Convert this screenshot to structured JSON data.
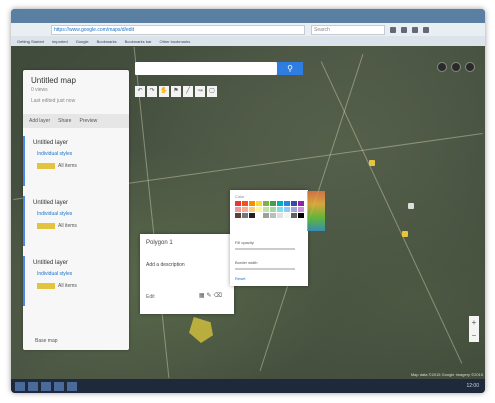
{
  "browser": {
    "url": "https://www.google.com/maps/d/edit",
    "search_placeholder": "Search",
    "bookmarks": [
      "Getting Started",
      "Imported",
      "Google",
      "Bookmarks",
      "Bookmarks bar",
      "Other bookmarks"
    ]
  },
  "panel": {
    "title": "Untitled map",
    "subtitle": "0 views",
    "description": "Last edited just now",
    "actions": [
      "Add layer",
      "Share",
      "Preview"
    ],
    "layers": [
      {
        "title": "Untitled layer",
        "mode": "Individual styles",
        "legend": "All items"
      },
      {
        "title": "Untitled layer",
        "mode": "Individual styles",
        "legend": "All items"
      },
      {
        "title": "Untitled layer",
        "mode": "Individual styles",
        "legend": "All items"
      }
    ],
    "basemap": "Base map"
  },
  "popup": {
    "title": "Polygon 1",
    "description": "Add a description",
    "edit_label": "Edit"
  },
  "style_panel": {
    "heading": "Color",
    "opacity_label": "Fill opacity",
    "width_label": "Border width",
    "reset_label": "Reset",
    "swatches": [
      "#e53935",
      "#f4511e",
      "#fb8c00",
      "#fdd835",
      "#7cb342",
      "#43a047",
      "#00acc1",
      "#1e88e5",
      "#3949ab",
      "#8e24aa",
      "#ef9a9a",
      "#ffab91",
      "#ffcc80",
      "#fff59d",
      "#c5e1a5",
      "#a5d6a7",
      "#80deea",
      "#90caf9",
      "#9fa8da",
      "#ce93d8",
      "#5d4037",
      "#757575",
      "#212121",
      "#ffffff",
      "#9e9e9e",
      "#bdbdbd",
      "#e0e0e0",
      "#f5f5f5",
      "#616161",
      "#000000"
    ]
  },
  "colors": {
    "accent": "#2f7de1",
    "polygon": "#e3c440"
  },
  "map_attribution": "Map data ©2015 Google Imagery ©2015",
  "taskbar_clock": "12:00"
}
